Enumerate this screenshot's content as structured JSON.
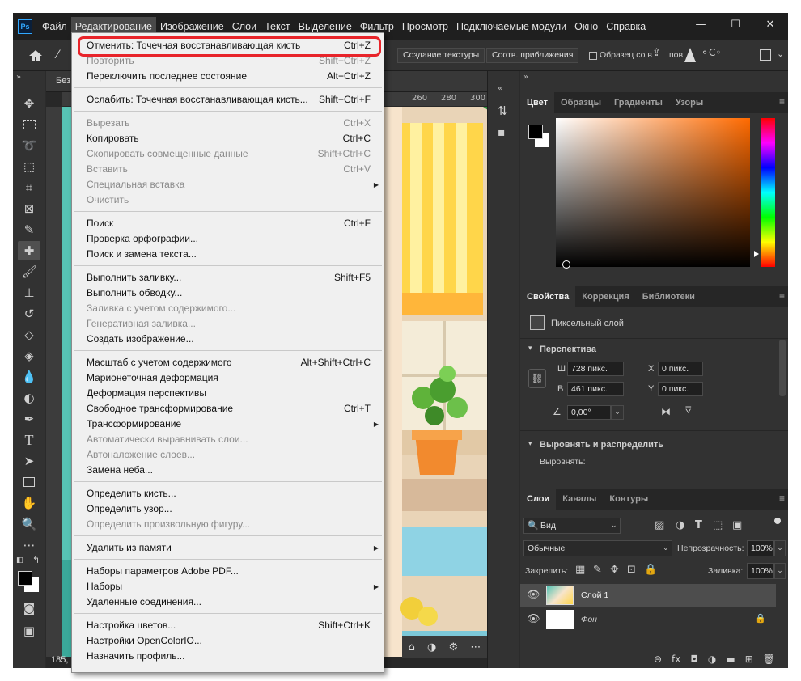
{
  "app": {
    "logo": "Ps"
  },
  "menubar": {
    "items": [
      "Файл",
      "Редактирование",
      "Изображение",
      "Слои",
      "Текст",
      "Выделение",
      "Фильтр",
      "Просмотр",
      "Подключаемые модули",
      "Окно",
      "Справка"
    ],
    "active": "Редактирование"
  },
  "window_controls": {
    "minimize": "—",
    "maximize": "☐",
    "close": "✕"
  },
  "options_bar": {
    "btn_texture": "Создание текстуры",
    "btn_match": "Соотв. приближения",
    "sample_all": "Образец со в",
    "sample_all_checked": false,
    "rotate_short": "пов"
  },
  "document": {
    "tab_title_fragment": "Без",
    "zoom": "185,",
    "ruler_ticks": [
      "260",
      "280",
      "300"
    ]
  },
  "edit_menu": {
    "items": [
      {
        "label": "Отменить: Точечная восстанавливающая кисть",
        "shortcut": "Ctrl+Z",
        "disabled": false,
        "highlighted": true
      },
      {
        "label": "Повторить",
        "shortcut": "Shift+Ctrl+Z",
        "disabled": true
      },
      {
        "label": "Переключить последнее состояние",
        "shortcut": "Alt+Ctrl+Z",
        "disabled": false
      },
      {
        "separator": true
      },
      {
        "label": "Ослабить: Точечная восстанавливающая кисть...",
        "shortcut": "Shift+Ctrl+F",
        "disabled": false
      },
      {
        "separator": true
      },
      {
        "label": "Вырезать",
        "shortcut": "Ctrl+X",
        "disabled": true
      },
      {
        "label": "Копировать",
        "shortcut": "Ctrl+C",
        "disabled": false
      },
      {
        "label": "Скопировать совмещенные данные",
        "shortcut": "Shift+Ctrl+C",
        "disabled": true
      },
      {
        "label": "Вставить",
        "shortcut": "Ctrl+V",
        "disabled": true
      },
      {
        "label": "Специальная вставка",
        "shortcut": "",
        "disabled": true,
        "submenu": true
      },
      {
        "label": "Очистить",
        "shortcut": "",
        "disabled": true
      },
      {
        "separator": true
      },
      {
        "label": "Поиск",
        "shortcut": "Ctrl+F",
        "disabled": false
      },
      {
        "label": "Проверка орфографии...",
        "shortcut": "",
        "disabled": false
      },
      {
        "label": "Поиск и замена текста...",
        "shortcut": "",
        "disabled": false
      },
      {
        "separator": true
      },
      {
        "label": "Выполнить заливку...",
        "shortcut": "Shift+F5",
        "disabled": false
      },
      {
        "label": "Выполнить обводку...",
        "shortcut": "",
        "disabled": false
      },
      {
        "label": "Заливка с учетом содержимого...",
        "shortcut": "",
        "disabled": true
      },
      {
        "label": "Генеративная заливка...",
        "shortcut": "",
        "disabled": true
      },
      {
        "label": "Создать изображение...",
        "shortcut": "",
        "disabled": false
      },
      {
        "separator": true
      },
      {
        "label": "Масштаб с учетом содержимого",
        "shortcut": "Alt+Shift+Ctrl+C",
        "disabled": false
      },
      {
        "label": "Марионеточная деформация",
        "shortcut": "",
        "disabled": false
      },
      {
        "label": "Деформация перспективы",
        "shortcut": "",
        "disabled": false
      },
      {
        "label": "Свободное трансформирование",
        "shortcut": "Ctrl+T",
        "disabled": false
      },
      {
        "label": "Трансформирование",
        "shortcut": "",
        "disabled": false,
        "submenu": true
      },
      {
        "label": "Автоматически выравнивать слои...",
        "shortcut": "",
        "disabled": true
      },
      {
        "label": "Автоналожение слоев...",
        "shortcut": "",
        "disabled": true
      },
      {
        "label": "Замена неба...",
        "shortcut": "",
        "disabled": false
      },
      {
        "separator": true
      },
      {
        "label": "Определить кисть...",
        "shortcut": "",
        "disabled": false
      },
      {
        "label": "Определить узор...",
        "shortcut": "",
        "disabled": false
      },
      {
        "label": "Определить произвольную фигуру...",
        "shortcut": "",
        "disabled": true
      },
      {
        "separator": true
      },
      {
        "label": "Удалить из памяти",
        "shortcut": "",
        "disabled": false,
        "submenu": true
      },
      {
        "separator": true
      },
      {
        "label": "Наборы параметров Adobe PDF...",
        "shortcut": "",
        "disabled": false
      },
      {
        "label": "Наборы",
        "shortcut": "",
        "disabled": false,
        "submenu": true
      },
      {
        "label": "Удаленные соединения...",
        "shortcut": "",
        "disabled": false
      },
      {
        "separator": true
      },
      {
        "label": "Настройка цветов...",
        "shortcut": "Shift+Ctrl+K",
        "disabled": false
      },
      {
        "label": "Настройки OpenColorIO...",
        "shortcut": "",
        "disabled": false
      },
      {
        "label": "Назначить профиль...",
        "shortcut": "",
        "disabled": false
      }
    ]
  },
  "color_panel": {
    "tabs": [
      "Цвет",
      "Образцы",
      "Градиенты",
      "Узоры"
    ],
    "active": "Цвет",
    "foreground": "#000000",
    "background": "#ffffff",
    "hue_color": "#ff6a00"
  },
  "properties_panel": {
    "tabs": [
      "Свойства",
      "Коррекция",
      "Библиотеки"
    ],
    "active": "Свойства",
    "layer_type": "Пиксельный слой",
    "perspective": {
      "title": "Перспектива",
      "w_label": "Ш",
      "w": "728 пикс.",
      "h_label": "В",
      "h": "461 пикс.",
      "x_label": "X",
      "x": "0 пикс.",
      "y_label": "Y",
      "y": "0 пикс.",
      "angle": "0,00°"
    },
    "align": {
      "title": "Выровнять и распределить",
      "label": "Выровнять:"
    }
  },
  "layers_panel": {
    "tabs": [
      "Слои",
      "Каналы",
      "Контуры"
    ],
    "active": "Слои",
    "filter": "Вид",
    "blend_mode": "Обычные",
    "opacity_label": "Непрозрачность:",
    "opacity": "100%",
    "lock_label": "Закрепить:",
    "fill_label": "Заливка:",
    "fill": "100%",
    "layers": [
      {
        "name": "Слой 1",
        "visible": true,
        "selected": true
      },
      {
        "name": "Фон",
        "visible": true,
        "locked": true,
        "italic": true
      }
    ]
  }
}
